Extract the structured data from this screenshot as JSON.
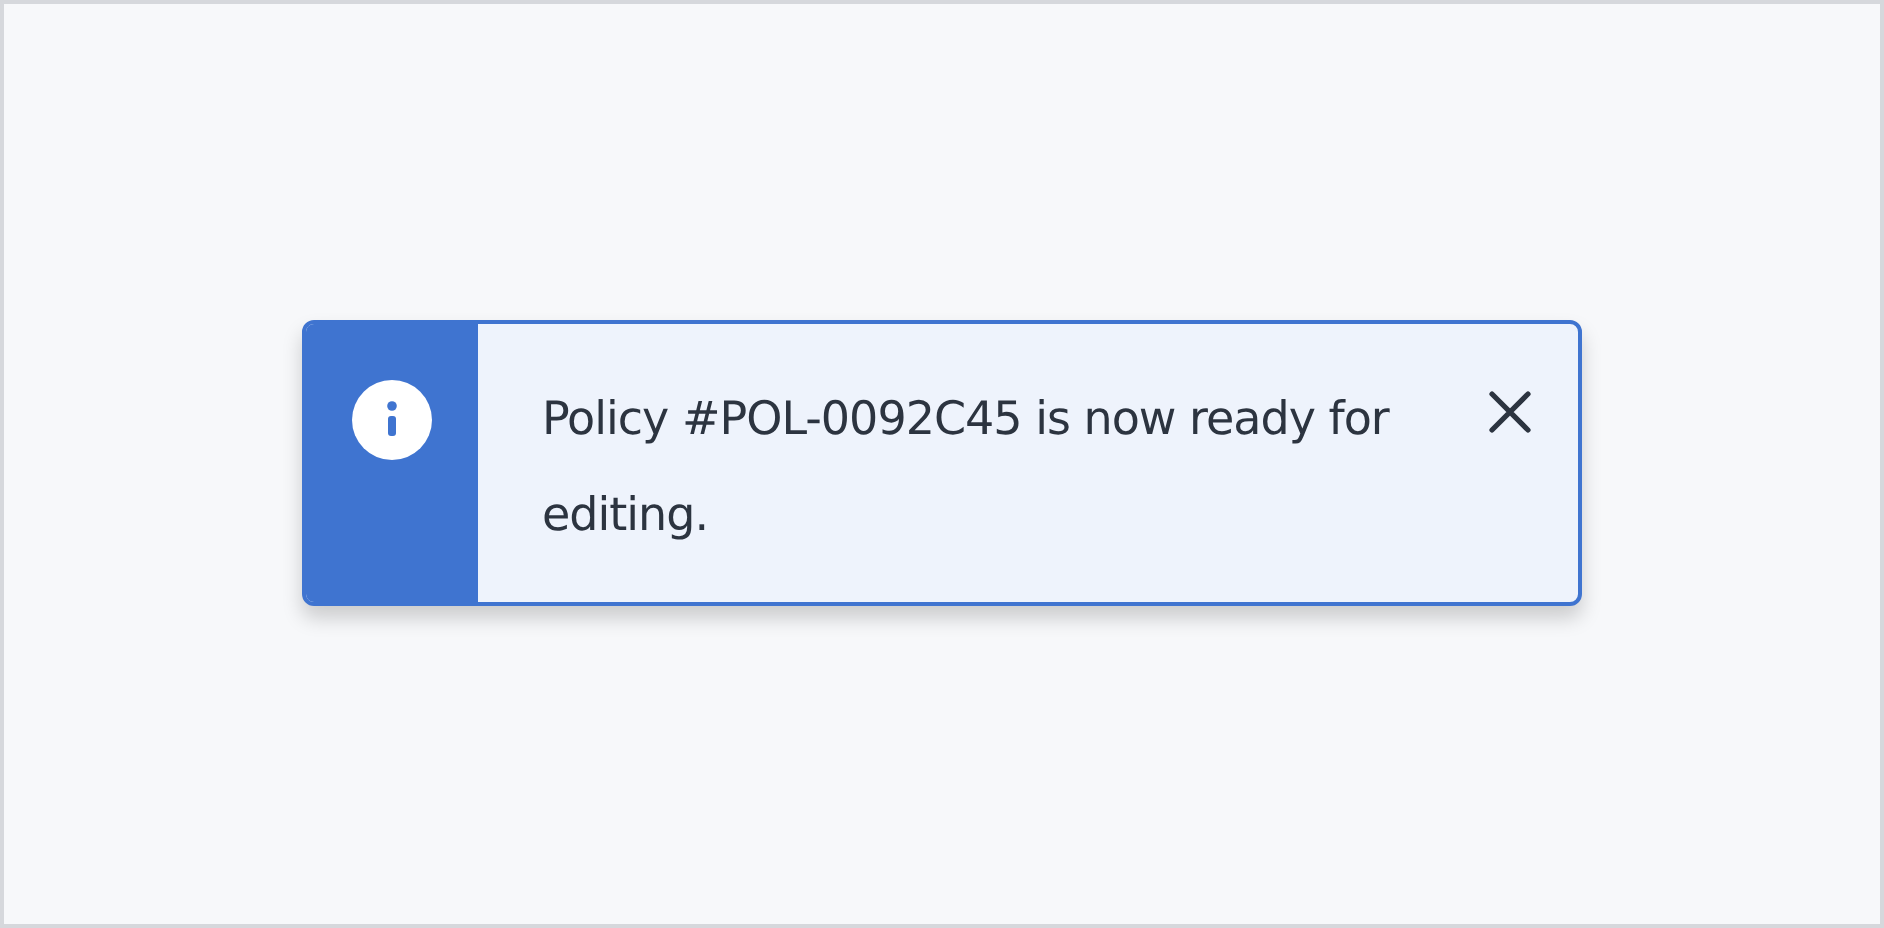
{
  "toast": {
    "kind": "info",
    "message": "Policy #POL-0092C45 is now ready for editing.",
    "dismissible": true
  }
}
